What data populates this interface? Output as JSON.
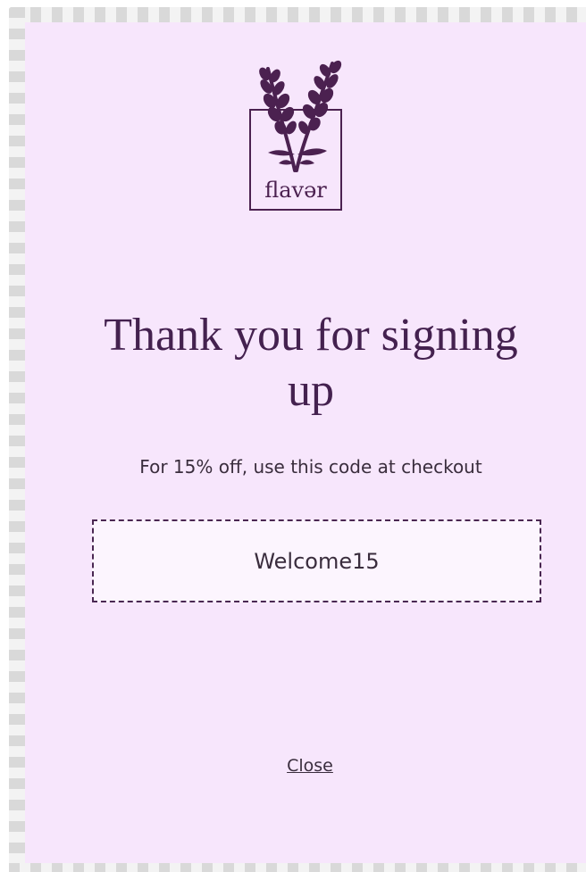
{
  "logo": {
    "icon": "lavender-sprig-icon",
    "text": "flavər"
  },
  "popup": {
    "title": "Thank you for signing up",
    "subtitle": "For 15% off, use this code at checkout",
    "code": "Welcome15",
    "close_label": "Close"
  },
  "colors": {
    "panel_bg": "#f7e6fc",
    "brand_purple": "#44214f",
    "code_box_bg": "#fcf5fe"
  }
}
